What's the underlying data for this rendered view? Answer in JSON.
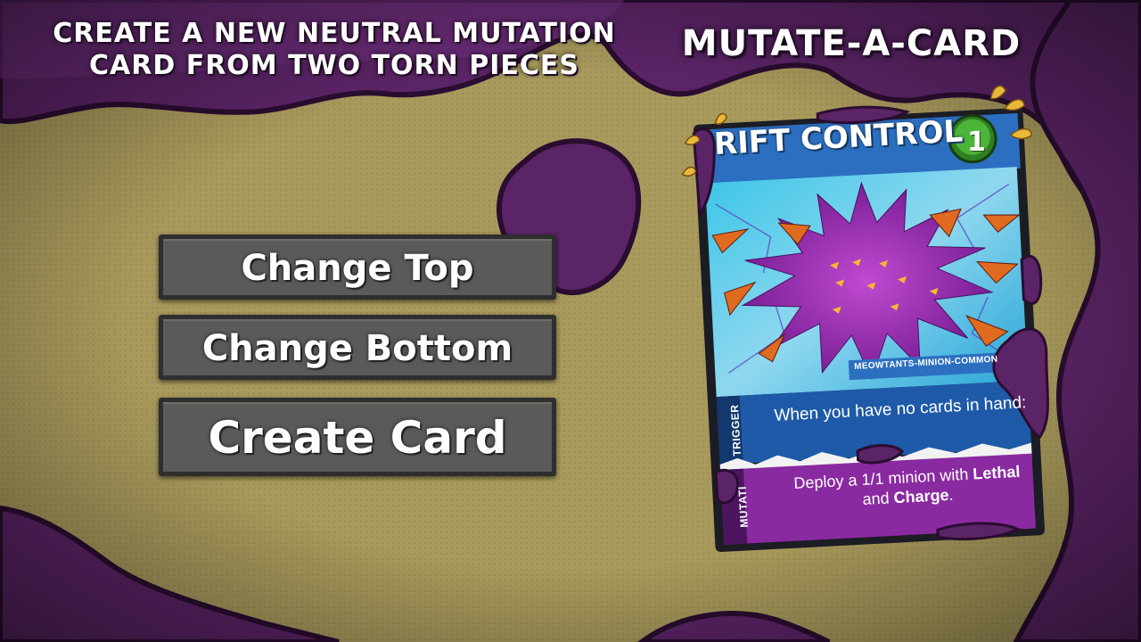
{
  "header": {
    "instruction_line1": "CREATE A NEW NEUTRAL MUTATION",
    "instruction_line2": "CARD FROM TWO TORN PIECES",
    "title": "MUTATE-A-CARD"
  },
  "buttons": {
    "change_top": "Change Top",
    "change_bottom": "Change Bottom",
    "create_card": "Create Card"
  },
  "card": {
    "name": "RIFT CONTROL",
    "cost": "1",
    "tag": "MEOWTANTS-MINION-COMMON",
    "trigger_label": "TRIGGER",
    "trigger_text": "When you have no cards in hand:",
    "mutation_label": "MUTATI",
    "mutation_text_1": "Deploy a 1/1 minion with ",
    "mutation_keyword_1": "Lethal",
    "mutation_text_2": "and ",
    "mutation_keyword_2": "Charge",
    "mutation_text_3": ".",
    "cost_color": "#3a9a2a",
    "frame_color": "#6a2c78",
    "art_color": "#8a2fb0"
  },
  "colors": {
    "background": "#a89a5c",
    "goo": "#5b2466",
    "button_face": "#5a5a58"
  }
}
